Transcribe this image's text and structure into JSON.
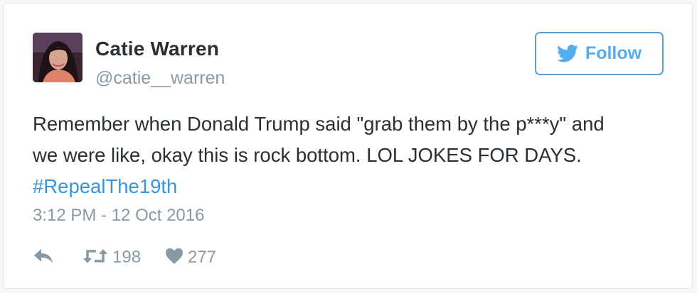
{
  "user": {
    "display_name": "Catie Warren",
    "handle": "@catie__warren"
  },
  "follow_button": {
    "label": "Follow",
    "icon": "twitter-bird-icon"
  },
  "tweet": {
    "text_line1": "Remember when Donald Trump said \"grab them by the p***y\" and",
    "text_line2": "we were like, okay this is rock bottom. LOL JOKES FOR DAYS.",
    "hashtag": "#RepealThe19th",
    "timestamp": "3:12 PM - 12 Oct 2016"
  },
  "actions": {
    "reply_icon": "reply-icon",
    "retweet_icon": "retweet-icon",
    "retweet_count": "198",
    "like_icon": "heart-icon",
    "like_count": "277"
  },
  "colors": {
    "text": "#292f33",
    "muted": "#8899a6",
    "link": "#3b94d9",
    "accent": "#55acee",
    "border": "#e1e8ed"
  }
}
